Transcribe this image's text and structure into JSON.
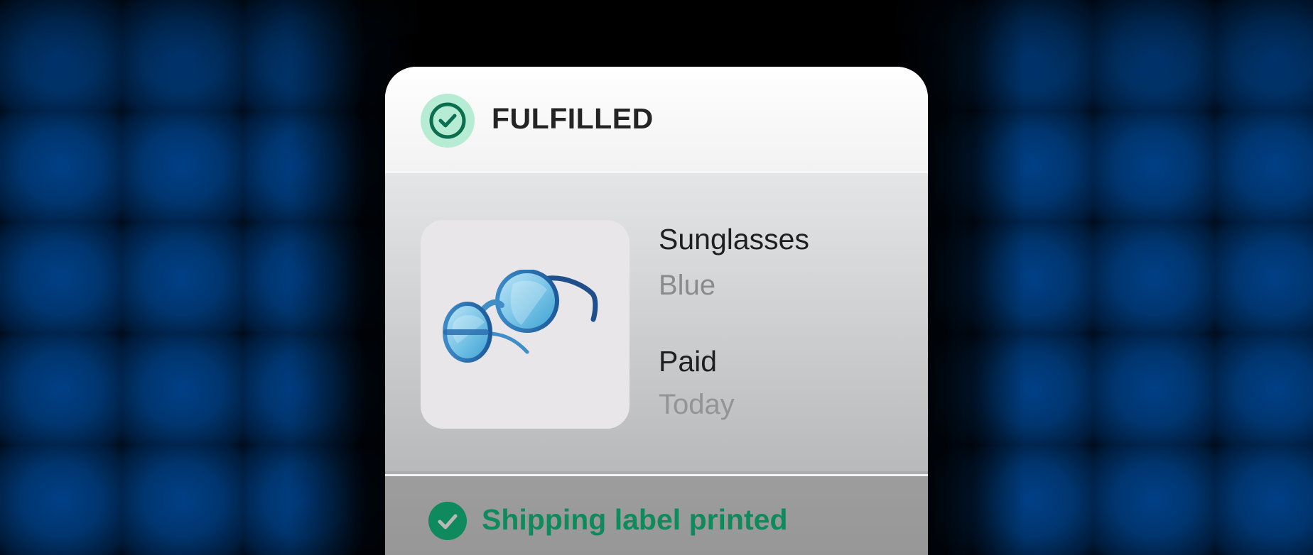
{
  "order_card": {
    "status": "FULFILLED",
    "product": {
      "name": "Sunglasses",
      "variant": "Blue",
      "image_icon": "sunglasses-image"
    },
    "payment": {
      "label": "Paid",
      "date": "Today"
    },
    "shipping": {
      "status": "Shipping label printed"
    }
  },
  "colors": {
    "status_icon_bg": "#b6ecd3",
    "status_icon_fg": "#0b6e4f",
    "shipping_text": "#0f8a5f",
    "background_blue": "#003f86"
  },
  "icons": {
    "status": "check-circle-icon",
    "shipping": "check-circle-filled-icon"
  }
}
